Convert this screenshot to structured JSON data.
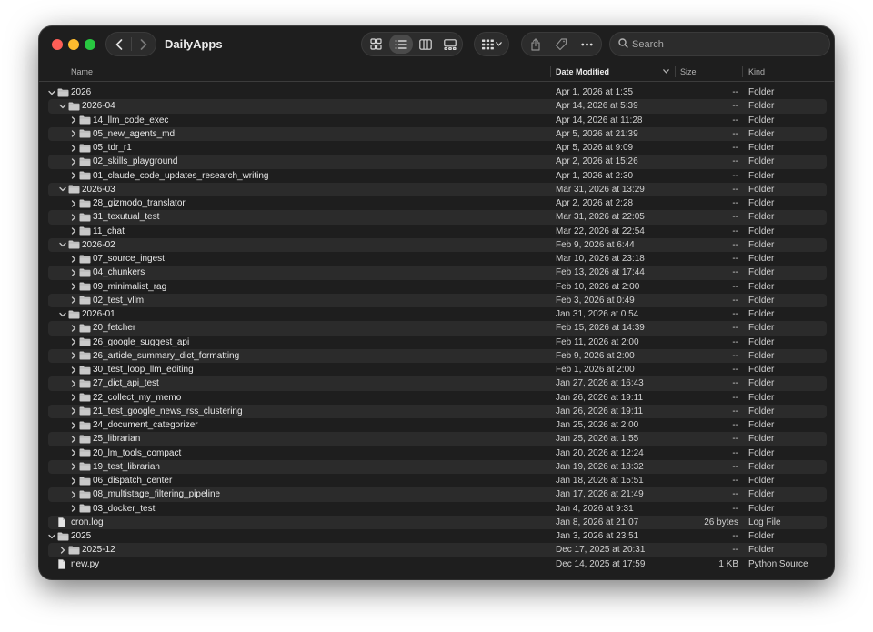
{
  "window": {
    "title": "DailyApps"
  },
  "search": {
    "placeholder": "Search"
  },
  "columns": {
    "name": "Name",
    "date": "Date Modified",
    "size": "Size",
    "kind": "Kind"
  },
  "colors": {
    "window_bg": "#1e1e1e",
    "alt_row": "#2b2b2b",
    "folder": "#c9c9c9"
  },
  "toolbar_icons": {
    "view_modes": [
      "icon-view-icon",
      "list-view-icon",
      "column-view-icon",
      "gallery-view-icon"
    ],
    "group": "group-by-icon",
    "actions": [
      "share-icon",
      "tag-icon",
      "more-icon"
    ]
  },
  "rows": [
    {
      "name": "2026",
      "date": "Apr 1, 2026 at 1:35",
      "size": "--",
      "kind": "Folder",
      "depth": 0,
      "type": "folder",
      "expanded": true
    },
    {
      "name": "2026-04",
      "date": "Apr 14, 2026 at 5:39",
      "size": "--",
      "kind": "Folder",
      "depth": 1,
      "type": "folder",
      "expanded": true
    },
    {
      "name": "14_llm_code_exec",
      "date": "Apr 14, 2026 at 11:28",
      "size": "--",
      "kind": "Folder",
      "depth": 2,
      "type": "folder",
      "expanded": false
    },
    {
      "name": "05_new_agents_md",
      "date": "Apr 5, 2026 at 21:39",
      "size": "--",
      "kind": "Folder",
      "depth": 2,
      "type": "folder",
      "expanded": false
    },
    {
      "name": "05_tdr_r1",
      "date": "Apr 5, 2026 at 9:09",
      "size": "--",
      "kind": "Folder",
      "depth": 2,
      "type": "folder",
      "expanded": false
    },
    {
      "name": "02_skills_playground",
      "date": "Apr 2, 2026 at 15:26",
      "size": "--",
      "kind": "Folder",
      "depth": 2,
      "type": "folder",
      "expanded": false
    },
    {
      "name": "01_claude_code_updates_research_writing",
      "date": "Apr 1, 2026 at 2:30",
      "size": "--",
      "kind": "Folder",
      "depth": 2,
      "type": "folder",
      "expanded": false
    },
    {
      "name": "2026-03",
      "date": "Mar 31, 2026 at 13:29",
      "size": "--",
      "kind": "Folder",
      "depth": 1,
      "type": "folder",
      "expanded": true
    },
    {
      "name": "28_gizmodo_translator",
      "date": "Apr 2, 2026 at 2:28",
      "size": "--",
      "kind": "Folder",
      "depth": 2,
      "type": "folder",
      "expanded": false
    },
    {
      "name": "31_texutual_test",
      "date": "Mar 31, 2026 at 22:05",
      "size": "--",
      "kind": "Folder",
      "depth": 2,
      "type": "folder",
      "expanded": false
    },
    {
      "name": "11_chat",
      "date": "Mar 22, 2026 at 22:54",
      "size": "--",
      "kind": "Folder",
      "depth": 2,
      "type": "folder",
      "expanded": false
    },
    {
      "name": "2026-02",
      "date": "Feb 9, 2026 at 6:44",
      "size": "--",
      "kind": "Folder",
      "depth": 1,
      "type": "folder",
      "expanded": true
    },
    {
      "name": "07_source_ingest",
      "date": "Mar 10, 2026 at 23:18",
      "size": "--",
      "kind": "Folder",
      "depth": 2,
      "type": "folder",
      "expanded": false
    },
    {
      "name": "04_chunkers",
      "date": "Feb 13, 2026 at 17:44",
      "size": "--",
      "kind": "Folder",
      "depth": 2,
      "type": "folder",
      "expanded": false
    },
    {
      "name": "09_minimalist_rag",
      "date": "Feb 10, 2026 at 2:00",
      "size": "--",
      "kind": "Folder",
      "depth": 2,
      "type": "folder",
      "expanded": false
    },
    {
      "name": "02_test_vllm",
      "date": "Feb 3, 2026 at 0:49",
      "size": "--",
      "kind": "Folder",
      "depth": 2,
      "type": "folder",
      "expanded": false
    },
    {
      "name": "2026-01",
      "date": "Jan 31, 2026 at 0:54",
      "size": "--",
      "kind": "Folder",
      "depth": 1,
      "type": "folder",
      "expanded": true
    },
    {
      "name": "20_fetcher",
      "date": "Feb 15, 2026 at 14:39",
      "size": "--",
      "kind": "Folder",
      "depth": 2,
      "type": "folder",
      "expanded": false
    },
    {
      "name": "26_google_suggest_api",
      "date": "Feb 11, 2026 at 2:00",
      "size": "--",
      "kind": "Folder",
      "depth": 2,
      "type": "folder",
      "expanded": false
    },
    {
      "name": "26_article_summary_dict_formatting",
      "date": "Feb 9, 2026 at 2:00",
      "size": "--",
      "kind": "Folder",
      "depth": 2,
      "type": "folder",
      "expanded": false
    },
    {
      "name": "30_test_loop_llm_editing",
      "date": "Feb 1, 2026 at 2:00",
      "size": "--",
      "kind": "Folder",
      "depth": 2,
      "type": "folder",
      "expanded": false
    },
    {
      "name": "27_dict_api_test",
      "date": "Jan 27, 2026 at 16:43",
      "size": "--",
      "kind": "Folder",
      "depth": 2,
      "type": "folder",
      "expanded": false
    },
    {
      "name": "22_collect_my_memo",
      "date": "Jan 26, 2026 at 19:11",
      "size": "--",
      "kind": "Folder",
      "depth": 2,
      "type": "folder",
      "expanded": false
    },
    {
      "name": "21_test_google_news_rss_clustering",
      "date": "Jan 26, 2026 at 19:11",
      "size": "--",
      "kind": "Folder",
      "depth": 2,
      "type": "folder",
      "expanded": false
    },
    {
      "name": "24_document_categorizer",
      "date": "Jan 25, 2026 at 2:00",
      "size": "--",
      "kind": "Folder",
      "depth": 2,
      "type": "folder",
      "expanded": false
    },
    {
      "name": "25_librarian",
      "date": "Jan 25, 2026 at 1:55",
      "size": "--",
      "kind": "Folder",
      "depth": 2,
      "type": "folder",
      "expanded": false
    },
    {
      "name": "20_lm_tools_compact",
      "date": "Jan 20, 2026 at 12:24",
      "size": "--",
      "kind": "Folder",
      "depth": 2,
      "type": "folder",
      "expanded": false
    },
    {
      "name": "19_test_librarian",
      "date": "Jan 19, 2026 at 18:32",
      "size": "--",
      "kind": "Folder",
      "depth": 2,
      "type": "folder",
      "expanded": false
    },
    {
      "name": "06_dispatch_center",
      "date": "Jan 18, 2026 at 15:51",
      "size": "--",
      "kind": "Folder",
      "depth": 2,
      "type": "folder",
      "expanded": false
    },
    {
      "name": "08_multistage_filtering_pipeline",
      "date": "Jan 17, 2026 at 21:49",
      "size": "--",
      "kind": "Folder",
      "depth": 2,
      "type": "folder",
      "expanded": false
    },
    {
      "name": "03_docker_test",
      "date": "Jan 4, 2026 at 9:31",
      "size": "--",
      "kind": "Folder",
      "depth": 2,
      "type": "folder",
      "expanded": false
    },
    {
      "name": "cron.log",
      "date": "Jan 8, 2026 at 21:07",
      "size": "26 bytes",
      "kind": "Log File",
      "depth": 0,
      "type": "file"
    },
    {
      "name": "2025",
      "date": "Jan 3, 2026 at 23:51",
      "size": "--",
      "kind": "Folder",
      "depth": 0,
      "type": "folder",
      "expanded": true
    },
    {
      "name": "2025-12",
      "date": "Dec 17, 2025 at 20:31",
      "size": "--",
      "kind": "Folder",
      "depth": 1,
      "type": "folder",
      "expanded": false
    },
    {
      "name": "new.py",
      "date": "Dec 14, 2025 at 17:59",
      "size": "1 KB",
      "kind": "Python Source",
      "depth": 0,
      "type": "file"
    }
  ]
}
